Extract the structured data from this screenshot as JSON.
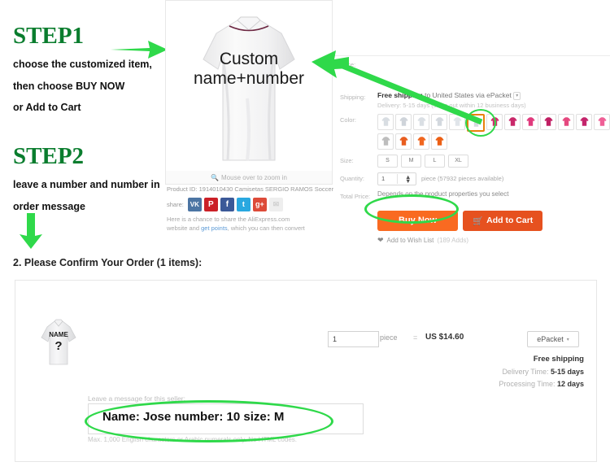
{
  "annotations": {
    "step1_title": "STEP1",
    "step1_lines": [
      "choose the customized item,",
      "then choose BUY NOW",
      "or Add to Cart"
    ],
    "step2_title": "STEP2",
    "step2_lines": [
      "leave a number and number in",
      "order message"
    ],
    "image_overlay_line1": "Custom",
    "image_overlay_line2": "name+number",
    "accent_color": "#2fd94a",
    "step_title_color": "#0a7d2e"
  },
  "product": {
    "zoom_hint": "Mouse over to zoom in",
    "product_id_line": "Product ID: 1914010430 Camisetas SERGIO RAMOS Soccer ...",
    "share_label": "share:",
    "share_buttons": [
      {
        "name": "vk",
        "glyph": "VK"
      },
      {
        "name": "pinterest",
        "glyph": "P"
      },
      {
        "name": "facebook",
        "glyph": "f"
      },
      {
        "name": "twitter",
        "glyph": "t"
      },
      {
        "name": "google-plus",
        "glyph": "g+"
      },
      {
        "name": "email",
        "glyph": "✉"
      }
    ],
    "share_note_1": "Here is a chance to share the AliExpress.com",
    "share_note_2a": "website and ",
    "share_note_link": "get points",
    "share_note_2b": ", which you can then convert"
  },
  "detail": {
    "price_label": "Price:",
    "price_value": "",
    "shipping_label": "Shipping:",
    "shipping_free": "Free shipping",
    "shipping_rest": " to United States via ePacket",
    "shipping_delivery": "Delivery: 5-15 days (ships out within 12 business days)",
    "color_label": "Color:",
    "color_swatches": [
      {
        "name": "white-1",
        "color": "#d8dde2",
        "selected": false
      },
      {
        "name": "white-2",
        "color": "#cfd4da",
        "selected": false
      },
      {
        "name": "white-3",
        "color": "#dadfe4",
        "selected": false
      },
      {
        "name": "white-4",
        "color": "#d3d8de",
        "selected": false
      },
      {
        "name": "white-5",
        "color": "#e0e5ea",
        "selected": false
      },
      {
        "name": "white-custom-selected",
        "color": "#d5dae0",
        "selected": true
      },
      {
        "name": "pink-1",
        "color": "#d62a6e",
        "selected": false
      },
      {
        "name": "pink-2",
        "color": "#c9286a",
        "selected": false
      },
      {
        "name": "pink-3",
        "color": "#e03a7d",
        "selected": false
      },
      {
        "name": "magenta-1",
        "color": "#c01f63",
        "selected": false
      },
      {
        "name": "pink-4",
        "color": "#e5487f",
        "selected": false
      },
      {
        "name": "magenta-2",
        "color": "#c4246b",
        "selected": false
      },
      {
        "name": "pink-light",
        "color": "#ef5f96",
        "selected": false
      },
      {
        "name": "grey-lock",
        "color": "#bdbdbd",
        "selected": false
      },
      {
        "name": "orange-1",
        "color": "#e85d1f",
        "selected": false
      },
      {
        "name": "orange-2",
        "color": "#f0661f",
        "selected": false
      },
      {
        "name": "orange-3",
        "color": "#ec5f14",
        "selected": false
      }
    ],
    "size_label": "Size:",
    "sizes": [
      "S",
      "M",
      "L",
      "XL"
    ],
    "quantity_label": "Quantity:",
    "quantity_value": "1",
    "quantity_note": "piece (57932 pieces available)",
    "total_price_label": "Total Price:",
    "total_price_value": "Depends on the product properties you select",
    "buy_now": "Buy Now",
    "add_to_cart": "Add to Cart",
    "wish_list": "Add to Wish List",
    "wish_count": "(189 Adds)"
  },
  "order": {
    "heading": "2. Please Confirm Your Order (1 items):",
    "thumb_name": "NAME",
    "thumb_number": "?",
    "quantity": "1",
    "piece_label": "piece",
    "equals": "=",
    "unit_price": "US $14.60",
    "shipping_method": "ePacket",
    "free_shipping": "Free shipping",
    "delivery_time_label": "Delivery Time:",
    "delivery_time_value": "5-15 days",
    "processing_time_label": "Processing Time:",
    "processing_time_value": "12 days",
    "message_label": "Leave a message for this seller:",
    "message_value": "Name: Jose number: 10 size: M",
    "message_note": "Max. 1,000 English characters or Arabic numerals only. No HTML codes."
  }
}
